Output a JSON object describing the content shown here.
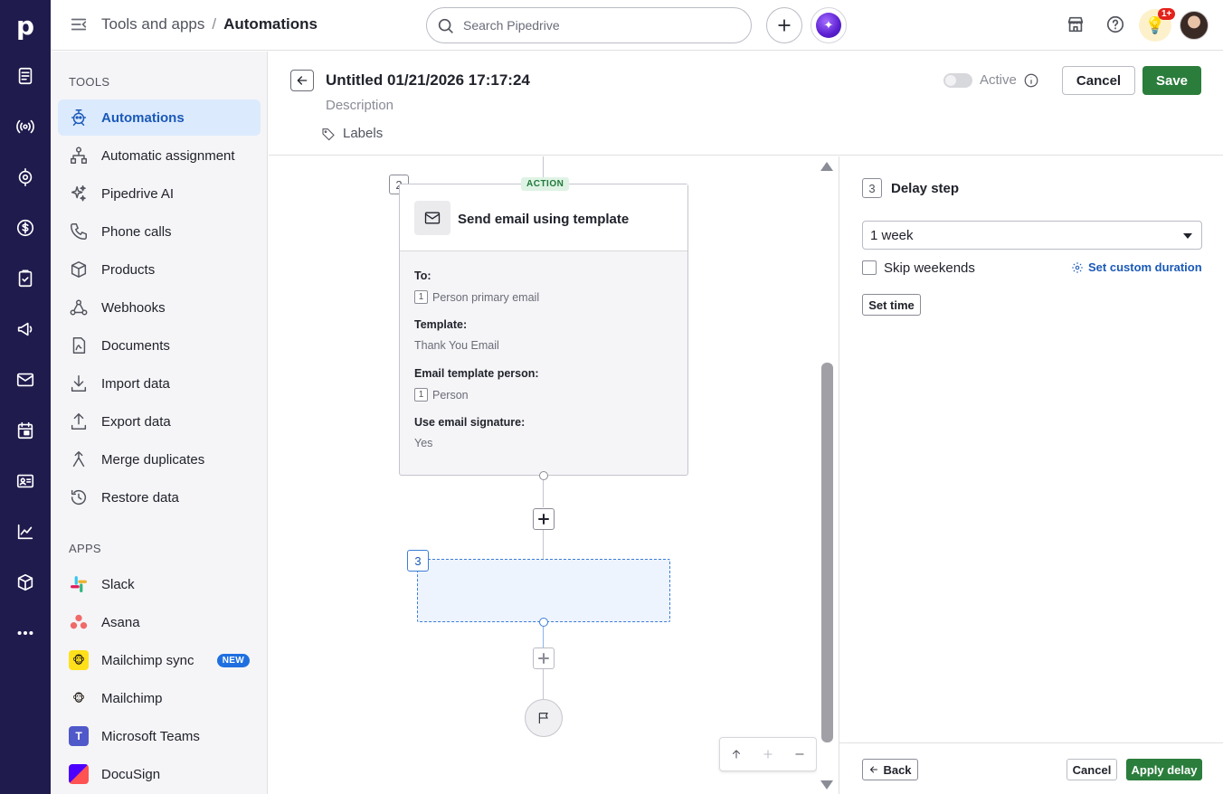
{
  "app": {
    "logo_letter": "p"
  },
  "rail": {
    "icons": [
      "leads-icon",
      "broadcast-icon",
      "target-icon",
      "deals-icon",
      "activities-icon",
      "campaigns-icon",
      "mail-icon",
      "calendar-icon",
      "contacts-icon",
      "insights-icon",
      "products-icon",
      "more-icon"
    ]
  },
  "topbar": {
    "breadcrumb_parent": "Tools and apps",
    "breadcrumb_sep": "/",
    "breadcrumb_current": "Automations",
    "search_placeholder": "Search Pipedrive",
    "notification_count": "1+"
  },
  "sidebar": {
    "tools_title": "TOOLS",
    "tools": [
      {
        "label": "Automations",
        "icon": "automations-icon",
        "active": true
      },
      {
        "label": "Automatic assignment",
        "icon": "assignment-icon"
      },
      {
        "label": "Pipedrive AI",
        "icon": "sparkle-icon"
      },
      {
        "label": "Phone calls",
        "icon": "phone-icon"
      },
      {
        "label": "Products",
        "icon": "box-icon"
      },
      {
        "label": "Webhooks",
        "icon": "webhook-icon"
      },
      {
        "label": "Documents",
        "icon": "document-icon"
      },
      {
        "label": "Import data",
        "icon": "import-icon"
      },
      {
        "label": "Export data",
        "icon": "export-icon"
      },
      {
        "label": "Merge duplicates",
        "icon": "merge-icon"
      },
      {
        "label": "Restore data",
        "icon": "restore-icon"
      }
    ],
    "apps_title": "APPS",
    "apps": [
      {
        "label": "Slack",
        "icon": "slack-icon"
      },
      {
        "label": "Asana",
        "icon": "asana-icon"
      },
      {
        "label": "Mailchimp sync",
        "icon": "mailchimp-icon",
        "badge": "NEW"
      },
      {
        "label": "Mailchimp",
        "icon": "mailchimp-icon"
      },
      {
        "label": "Microsoft Teams",
        "icon": "teams-icon"
      },
      {
        "label": "DocuSign",
        "icon": "docusign-icon"
      }
    ]
  },
  "editor": {
    "title": "Untitled 01/21/2026 17:17:24",
    "description_placeholder": "Description",
    "labels_label": "Labels",
    "active_label": "Active",
    "cancel_label": "Cancel",
    "save_label": "Save"
  },
  "canvas": {
    "step2": {
      "number": "2",
      "tag": "ACTION",
      "title": "Send email using template",
      "fields": [
        {
          "label": "To:",
          "ref": "1",
          "value": "Person primary email"
        },
        {
          "label": "Template:",
          "value": "Thank You Email"
        },
        {
          "label": "Email template person:",
          "ref": "1",
          "value": "Person"
        },
        {
          "label": "Use email signature:",
          "value": "Yes"
        }
      ]
    },
    "step3": {
      "number": "3"
    }
  },
  "panel": {
    "step_number": "3",
    "title": "Delay step",
    "duration_value": "1 week",
    "skip_weekends_label": "Skip weekends",
    "custom_duration_label": "Set custom duration",
    "set_time_label": "Set time",
    "back_label": "Back",
    "cancel_label": "Cancel",
    "apply_label": "Apply delay"
  },
  "colors": {
    "rail": "#1f1b4d",
    "accent": "#1a59b8",
    "primary_button": "#2b7d3c",
    "active_nav_bg": "#dceafd"
  }
}
